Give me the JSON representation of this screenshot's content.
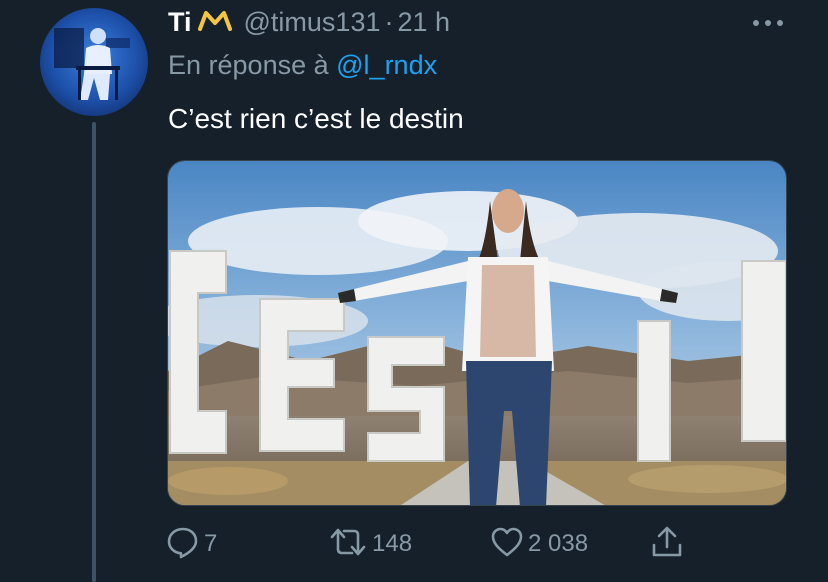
{
  "tweet": {
    "display_name": "Ti",
    "handle": "@timus131",
    "separator": "·",
    "time": "21 h",
    "reply_prefix": "En réponse à",
    "reply_mention": "@l_rndx",
    "text": "C’est rien c’est le destin",
    "name_badge": "crown-icon",
    "colors": {
      "background": "#15202b",
      "secondary_text": "#8899a6",
      "link": "#1da1f2",
      "badge": "#f5c542"
    }
  },
  "actions": {
    "reply": {
      "icon": "reply-icon",
      "count": "7"
    },
    "retweet": {
      "icon": "retweet-icon",
      "count": "148"
    },
    "like": {
      "icon": "heart-icon",
      "count": "2 038"
    },
    "share": {
      "icon": "share-icon"
    }
  }
}
